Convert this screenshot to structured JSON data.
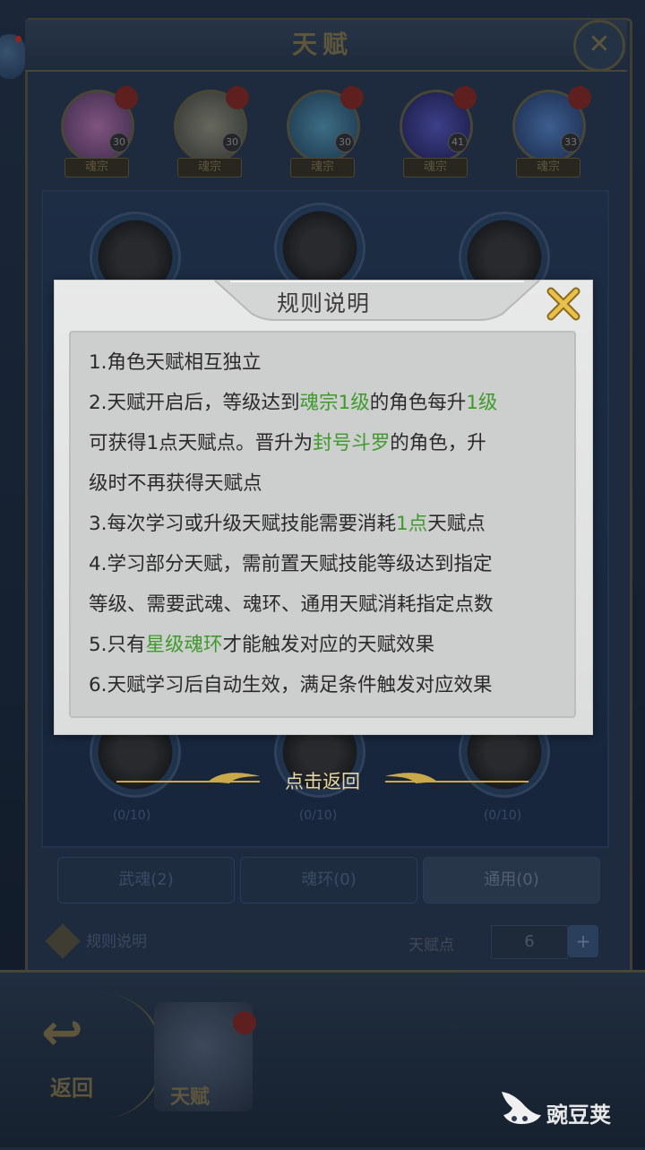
{
  "background": {
    "title": "天赋",
    "avatars": [
      {
        "tag": "魂宗",
        "level": "30"
      },
      {
        "tag": "魂宗",
        "level": "30"
      },
      {
        "tag": "魂宗",
        "level": "30"
      },
      {
        "tag": "魂宗",
        "level": "41"
      },
      {
        "tag": "魂宗",
        "level": "33"
      }
    ],
    "skill_counts": [
      "(0/10)",
      "(0/10)",
      "(0/10)"
    ],
    "tabs": [
      "武魂(2)",
      "魂环(0)",
      "通用(0)"
    ],
    "rule_link": "规则说明",
    "points_label": "天赋点",
    "points_value": "6",
    "footer_back": "返回",
    "footer_talent": "天赋"
  },
  "modal": {
    "title": "规则说明",
    "rules": [
      [
        {
          "t": "1.角色天赋相互独立"
        }
      ],
      [
        {
          "t": "2.天赋开启后，等级达到"
        },
        {
          "t": "魂宗1级",
          "hl": true
        },
        {
          "t": "的角色每升"
        },
        {
          "t": "1级",
          "hl": true
        }
      ],
      [
        {
          "t": "可获得1点天赋点。晋升为"
        },
        {
          "t": "封号斗罗",
          "hl": true
        },
        {
          "t": "的角色，升"
        }
      ],
      [
        {
          "t": "级时不再获得天赋点"
        }
      ],
      [
        {
          "t": "3.每次学习或升级天赋技能需要消耗"
        },
        {
          "t": "1点",
          "hl": true
        },
        {
          "t": "天赋点"
        }
      ],
      [
        {
          "t": "4.学习部分天赋，需前置天赋技能等级达到指定"
        }
      ],
      [
        {
          "t": "等级、需要武魂、魂环、通用天赋消耗指定点数"
        }
      ],
      [
        {
          "t": "5.只有"
        },
        {
          "t": "星级魂环",
          "hl": true
        },
        {
          "t": "才能触发对应的天赋效果"
        }
      ],
      [
        {
          "t": "6.天赋学习后自动生效，满足条件触发对应效果"
        }
      ]
    ],
    "back_label": "点击返回"
  },
  "colors": {
    "highlight": "#3f9a2c",
    "modal_bg": "#e8e9e9",
    "gold": "#c9a94a"
  },
  "watermark": "豌豆荚"
}
